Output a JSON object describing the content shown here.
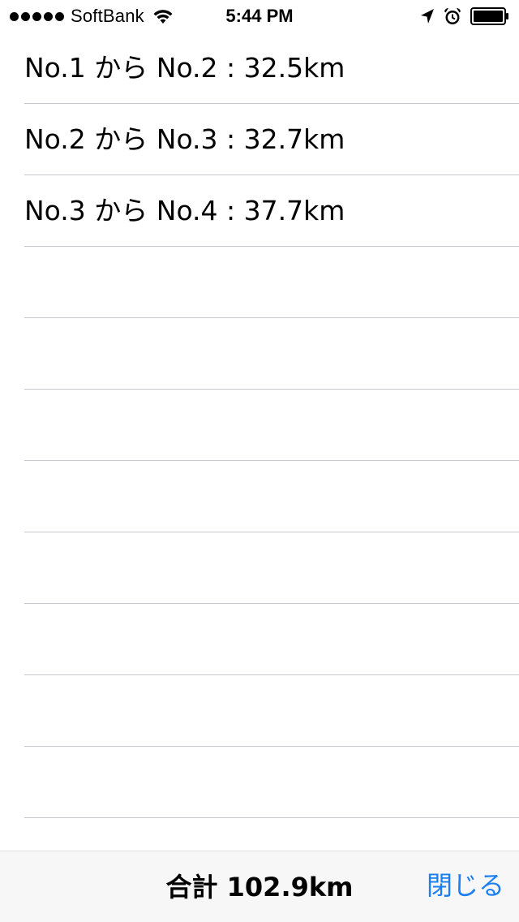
{
  "status_bar": {
    "carrier": "SoftBank",
    "time": "5:44 PM",
    "signal_bars": 5,
    "icons": [
      "signal-dots-icon",
      "wifi-icon",
      "location-arrow-icon",
      "alarm-clock-icon",
      "battery-icon"
    ]
  },
  "segments": [
    {
      "label": "No.1 から No.2 : 32.5km"
    },
    {
      "label": "No.2 から No.3 : 32.7km"
    },
    {
      "label": "No.3 から No.4 : 37.7km"
    },
    {
      "label": ""
    },
    {
      "label": ""
    },
    {
      "label": ""
    },
    {
      "label": ""
    },
    {
      "label": ""
    },
    {
      "label": ""
    },
    {
      "label": ""
    },
    {
      "label": ""
    }
  ],
  "toolbar": {
    "total": "合計 102.9km",
    "close_label": "閉じる"
  },
  "colors": {
    "accent": "#1a7ff2",
    "separator": "#c8c7cc",
    "toolbar_bg": "#f7f7f7"
  }
}
